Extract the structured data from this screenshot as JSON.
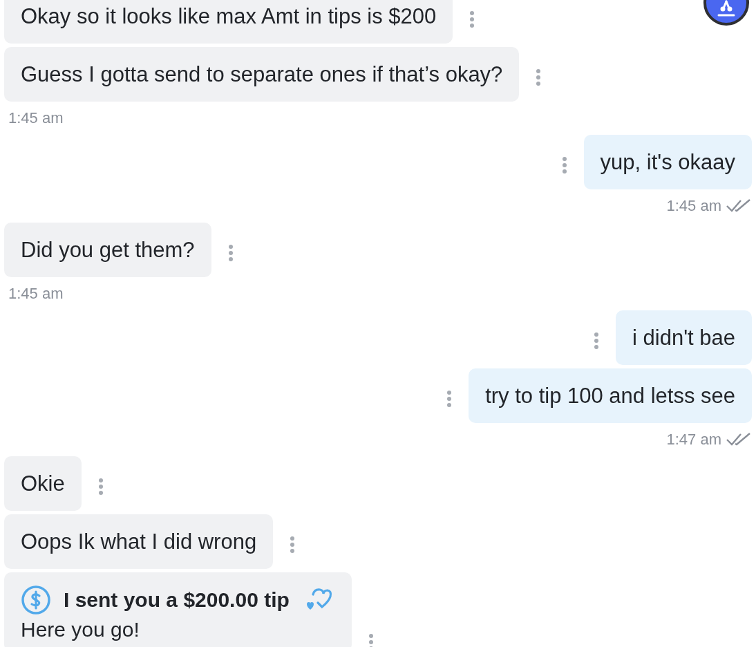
{
  "messages": [
    {
      "kind": "bubble",
      "outgoing": false,
      "text": "Okay so it looks like max Amt in tips is $200"
    },
    {
      "kind": "bubble",
      "outgoing": false,
      "text": "Guess I gotta send to separate ones if that’s okay?"
    },
    {
      "kind": "time",
      "outgoing": false,
      "text": "1:45 am"
    },
    {
      "kind": "bubble",
      "outgoing": true,
      "text": "yup, it's okaay"
    },
    {
      "kind": "time",
      "outgoing": true,
      "text": "1:45 am",
      "read": true
    },
    {
      "kind": "bubble",
      "outgoing": false,
      "text": "Did you get them?"
    },
    {
      "kind": "time",
      "outgoing": false,
      "text": "1:45 am"
    },
    {
      "kind": "bubble",
      "outgoing": true,
      "text": "i didn't bae"
    },
    {
      "kind": "bubble",
      "outgoing": true,
      "text": "try to tip 100 and letss see"
    },
    {
      "kind": "time",
      "outgoing": true,
      "text": "1:47 am",
      "read": true
    },
    {
      "kind": "bubble",
      "outgoing": false,
      "text": "Okie"
    },
    {
      "kind": "bubble",
      "outgoing": false,
      "text": "Oops Ik what I did wrong"
    },
    {
      "kind": "tip",
      "outgoing": false,
      "title": "I sent you a $200.00 tip",
      "text": "Here you go!"
    }
  ]
}
